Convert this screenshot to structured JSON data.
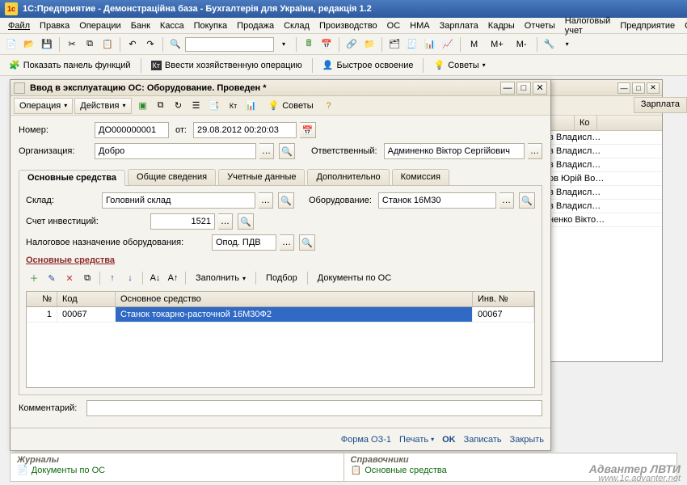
{
  "app": {
    "title": "1С:Предприятие - Демонстраційна база - Бухгалтерія для України, редакція 1.2",
    "logo_text": "1c"
  },
  "menu": [
    "Файл",
    "Правка",
    "Операции",
    "Банк",
    "Касса",
    "Покупка",
    "Продажа",
    "Склад",
    "Производство",
    "ОС",
    "НМА",
    "Зарплата",
    "Кадры",
    "Отчеты",
    "Налоговый учет",
    "Предприятие",
    "С"
  ],
  "toolbar2": {
    "show_panel": "Показать панель функций",
    "enter_op": "Ввести хозяйственную операцию",
    "quick_start": "Быстрое освоение",
    "tips": "Советы"
  },
  "m_buttons": [
    "M",
    "M+",
    "M-"
  ],
  "bg_tab": "Зарплата",
  "bg_list": {
    "col1": "ственный",
    "col2": "Ко",
    "rows": [
      "в Владисл…",
      "в Владисл…",
      "в Владисл…",
      "ов Юрій Во…",
      "в Владисл…",
      "в Владисл…",
      "ненко Вікто…"
    ]
  },
  "dialog": {
    "title": "Ввод в эксплуатацию ОС: Оборудование. Проведен *",
    "tb": {
      "operation": "Операция",
      "actions": "Действия",
      "tips": "Советы"
    },
    "fields": {
      "number_label": "Номер:",
      "number": "ДО000000001",
      "from_label": "от:",
      "date": "29.08.2012 00:20:03",
      "org_label": "Организация:",
      "org": "Добро",
      "resp_label": "Ответственный:",
      "resp": "Админенко Віктор Сергійович"
    },
    "tabs": [
      "Основные средства",
      "Общие сведения",
      "Учетные данные",
      "Дополнительно",
      "Комиссия"
    ],
    "tab1": {
      "sklad_label": "Склад:",
      "sklad": "Головний склад",
      "equip_label": "Оборудование:",
      "equip": "Станок 16М30",
      "invest_label": "Счет инвестиций:",
      "invest": "1521",
      "tax_label": "Налоговое назначение оборудования:",
      "tax": "Опод. ПДВ",
      "section": "Основные средства",
      "fill": "Заполнить",
      "select": "Подбор",
      "docs": "Документы по ОС",
      "cols": {
        "n": "№",
        "code": "Код",
        "name": "Основное средство",
        "inv": "Инв. №"
      },
      "row": {
        "n": "1",
        "code": "00067",
        "name": "Станок токарно-расточной 16М30Ф2",
        "inv": "00067"
      }
    },
    "comment_label": "Комментарий:",
    "footer": {
      "form": "Форма ОЗ-1",
      "print": "Печать",
      "ok": "OK",
      "save": "Записать",
      "close": "Закрыть"
    }
  },
  "bottom": {
    "left_title": "Журналы",
    "left_link": "Документы по ОС",
    "right_title": "Справочники",
    "right_link": "Основные средства"
  },
  "watermark": {
    "line1": "Адвантер ЛВТИ",
    "line2": "www.1c.advanter.net"
  }
}
